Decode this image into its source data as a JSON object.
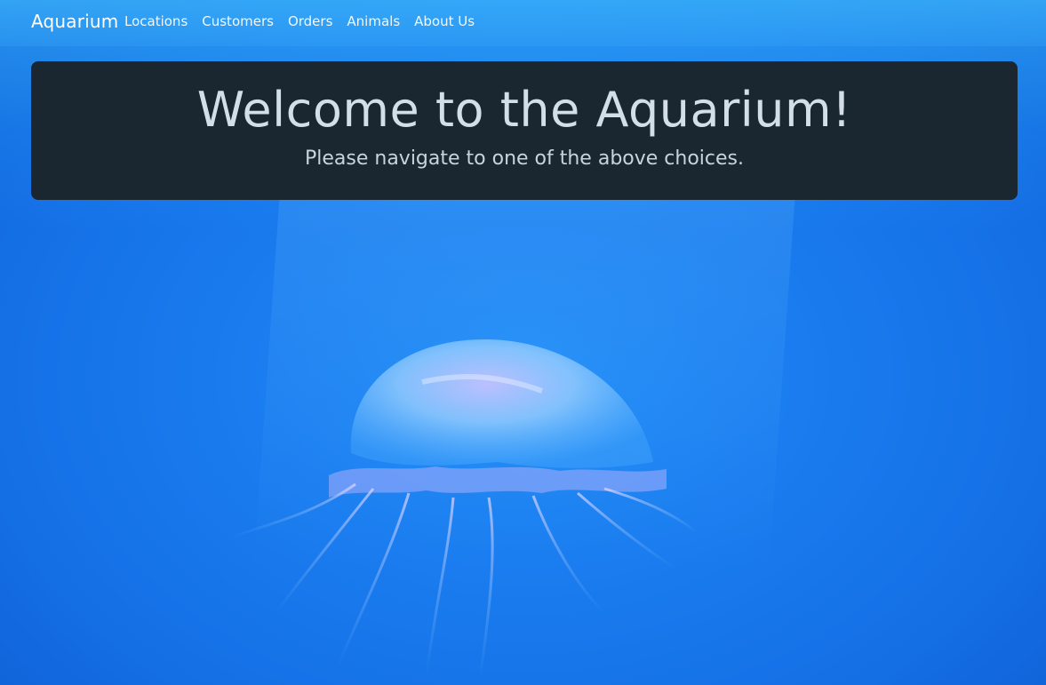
{
  "navbar": {
    "brand": "Aquarium",
    "links": [
      {
        "label": "Locations"
      },
      {
        "label": "Customers"
      },
      {
        "label": "Orders"
      },
      {
        "label": "Animals"
      },
      {
        "label": "About Us"
      }
    ]
  },
  "jumbotron": {
    "title": "Welcome to the Aquarium!",
    "subtitle": "Please navigate to one of the above choices."
  },
  "background": {
    "subject": "jellyfish",
    "colors": {
      "water": "#1a7df0",
      "panel": "#1a2630"
    }
  }
}
